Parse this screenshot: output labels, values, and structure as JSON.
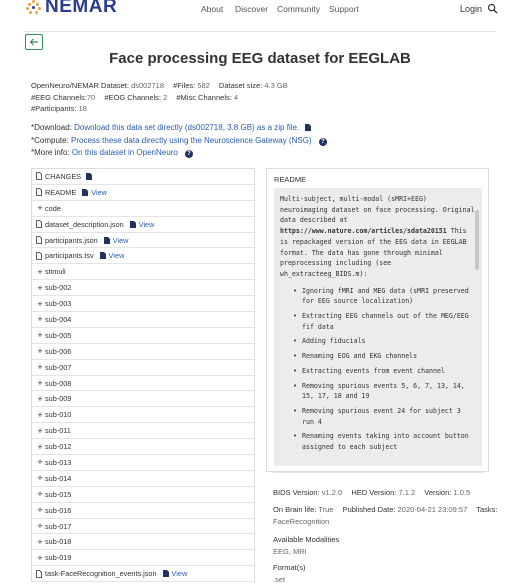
{
  "nav": {
    "logo": "NEMAR",
    "links": [
      "About",
      "Discover",
      "Community",
      "Support"
    ],
    "login": "Login"
  },
  "title": "Face processing EEG dataset for EEGLAB",
  "meta": {
    "dataset_label": "OpenNeuro/NEMAR Dataset:",
    "dataset_value": "ds002718",
    "files_label": "#Files:",
    "files_value": "582",
    "size_label": "Dataset size:",
    "size_value": "4.3 GB",
    "eeg_label": "#EEG Channels:",
    "eeg_value": "70",
    "eog_label": "#EOG Channels:",
    "eog_value": "2",
    "misc_label": "#Misc Channels:",
    "misc_value": "4",
    "participants_label": "#Participants:",
    "participants_value": "18"
  },
  "links": {
    "download_label": "*Download:",
    "download_text": "Download this data set directly (ds002718, 3.8 GB) as a zip file.",
    "compute_label": "*Compute:",
    "compute_text": "Process these data directly using the Neuroscience Gateway (NSG)",
    "info_label": "*More info:",
    "info_text": "On this dataset in OpenNeuro"
  },
  "view_label": "View",
  "tree": [
    {
      "type": "file",
      "name": "CHANGES",
      "doc": true
    },
    {
      "type": "file",
      "name": "README",
      "view": true
    },
    {
      "type": "folder",
      "name": "code"
    },
    {
      "type": "file",
      "name": "dataset_description.json",
      "view": true
    },
    {
      "type": "file",
      "name": "participants.json",
      "view": true
    },
    {
      "type": "file",
      "name": "participants.tsv",
      "view": true
    },
    {
      "type": "folder",
      "name": "stimuli"
    },
    {
      "type": "folder",
      "name": "sub-002"
    },
    {
      "type": "folder",
      "name": "sub-003"
    },
    {
      "type": "folder",
      "name": "sub-004"
    },
    {
      "type": "folder",
      "name": "sub-005"
    },
    {
      "type": "folder",
      "name": "sub-006"
    },
    {
      "type": "folder",
      "name": "sub-007"
    },
    {
      "type": "folder",
      "name": "sub-008"
    },
    {
      "type": "folder",
      "name": "sub-009"
    },
    {
      "type": "folder",
      "name": "sub-010"
    },
    {
      "type": "folder",
      "name": "sub-011"
    },
    {
      "type": "folder",
      "name": "sub-012"
    },
    {
      "type": "folder",
      "name": "sub-013"
    },
    {
      "type": "folder",
      "name": "sub-014"
    },
    {
      "type": "folder",
      "name": "sub-015"
    },
    {
      "type": "folder",
      "name": "sub-016"
    },
    {
      "type": "folder",
      "name": "sub-017"
    },
    {
      "type": "folder",
      "name": "sub-018"
    },
    {
      "type": "folder",
      "name": "sub-019"
    },
    {
      "type": "file",
      "name": "task-FaceRecognition_events.json",
      "view": true
    }
  ],
  "readme": {
    "title": "README",
    "p1": "Multi-subject, multi-modal (sMRI+EEG) neuroimaging dataset on face processing. Original data described at",
    "url": "https://www.nature.com/articles/sdata20151",
    "p2": "This is repackaged version of the EEG data in EEGLAB format. The data has gone through minimal preprocessing including (see wh_extracteeg_BIDS.m):",
    "items": [
      "Ignoring fMRI and MEG data (sMRI preserved for EEG source localization)",
      "Extracting EEG channels out of the MEG/EEG fif data",
      "Adding fiducials",
      "Renaming EOG and EKG channels",
      "Extracting events from event channel",
      "Removing spurious events 5, 6, 7, 13, 14, 15, 17, 18 and 19",
      "Removing spurious event 24 for subject 3 run 4",
      "Renaming events taking into account button assigned to each subject"
    ]
  },
  "info": {
    "bids_label": "BIDS Version:",
    "bids_value": "v1.2.0",
    "hed_label": "HED Version:",
    "hed_value": "7.1.2",
    "ver_label": "Version:",
    "ver_value": "1.0.5",
    "brain_label": "On Brain life:",
    "brain_value": "True",
    "pub_label": "Published Date:",
    "pub_value": "2020-04-21 23:09:57",
    "tasks_label": "Tasks:",
    "tasks_value": "FaceRecognition",
    "modalities_label": "Available Modalities",
    "modalities_value": "EEG, MRI",
    "formats_label": "Format(s)",
    "formats_value": ".set"
  },
  "colors": {
    "brand": "#2a3c8f",
    "link": "#2a5db0",
    "accent": "#3d8a5c"
  },
  "icons": [
    "logo-dots-icon",
    "search-icon",
    "back-arrow-icon",
    "document-icon",
    "help-icon",
    "plus-icon",
    "file-icon"
  ]
}
